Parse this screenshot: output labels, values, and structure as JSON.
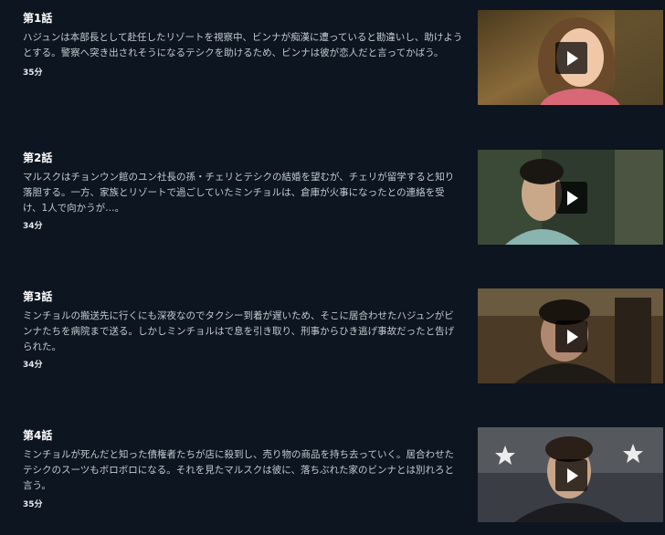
{
  "episodes": [
    {
      "title": "第1話",
      "description": "ハジュンは本部長として赴任したリゾートを視察中、ビンナが痴漢に遭っていると勘違いし、助けようとする。警察へ突き出されそうになるテシクを助けるため、ビンナは彼が恋人だと言ってかばう。",
      "duration": "35分",
      "thumbnail_icon": "episode-1-still"
    },
    {
      "title": "第2話",
      "description": "マルスクはチョンウン館のユン社長の孫・チェリとテシクの結婚を望むが、チェリが留学すると知り落胆する。一方、家族とリゾートで過ごしていたミンチョルは、倉庫が火事になったとの連絡を受け、1人で向かうが…。",
      "duration": "34分",
      "thumbnail_icon": "episode-2-still"
    },
    {
      "title": "第3話",
      "description": "ミンチョルの搬送先に行くにも深夜なのでタクシー到着が遅いため、そこに居合わせたハジュンがビンナたちを病院まで送る。しかしミンチョルはで息を引き取り、刑事からひき逃げ事故だったと告げられた。",
      "duration": "34分",
      "thumbnail_icon": "episode-3-still"
    },
    {
      "title": "第4話",
      "description": "ミンチョルが死んだと知った債権者たちが店に殺到し、売り物の商品を持ち去っていく。居合わせたテシクのスーツもボロボロになる。それを見たマルスクは彼に、落ちぶれた家のビンナとは別れろと言う。",
      "duration": "35分",
      "thumbnail_icon": "episode-4-still"
    }
  ],
  "colors": {
    "background": "#0c1520",
    "title": "#ffffff",
    "description": "#c4cad1",
    "play_button_bg": "rgba(0,0,0,0.72)"
  }
}
